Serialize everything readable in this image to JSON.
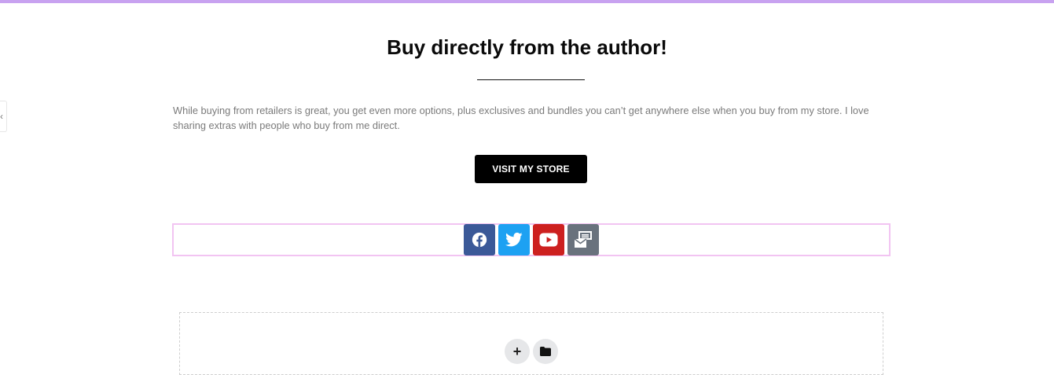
{
  "header": {
    "title": "Buy directly from the author!"
  },
  "intro": {
    "text": "While buying from retailers is great, you get even more options, plus exclusives and bundles you can’t get anywhere else when you buy from my store. I love sharing extras with people who buy from me direct."
  },
  "cta": {
    "label": "VISIT MY STORE"
  },
  "sidebar_toggle": {
    "glyph": "‹"
  },
  "social": [
    {
      "icon": "facebook-icon",
      "color": "#3b5998"
    },
    {
      "icon": "twitter-icon",
      "color": "#1da1f2"
    },
    {
      "icon": "youtube-icon",
      "color": "#cd201f"
    },
    {
      "icon": "envelope-open-text-icon",
      "color": "#69727d"
    }
  ],
  "editor": {
    "add_glyph": "+",
    "folder_icon": "folder-icon"
  },
  "colors": {
    "accent_top_bar": "#c8a2f0",
    "section_outline": "#f2c4f2",
    "button_bg": "#000000",
    "body_text": "#7a7a7a"
  }
}
